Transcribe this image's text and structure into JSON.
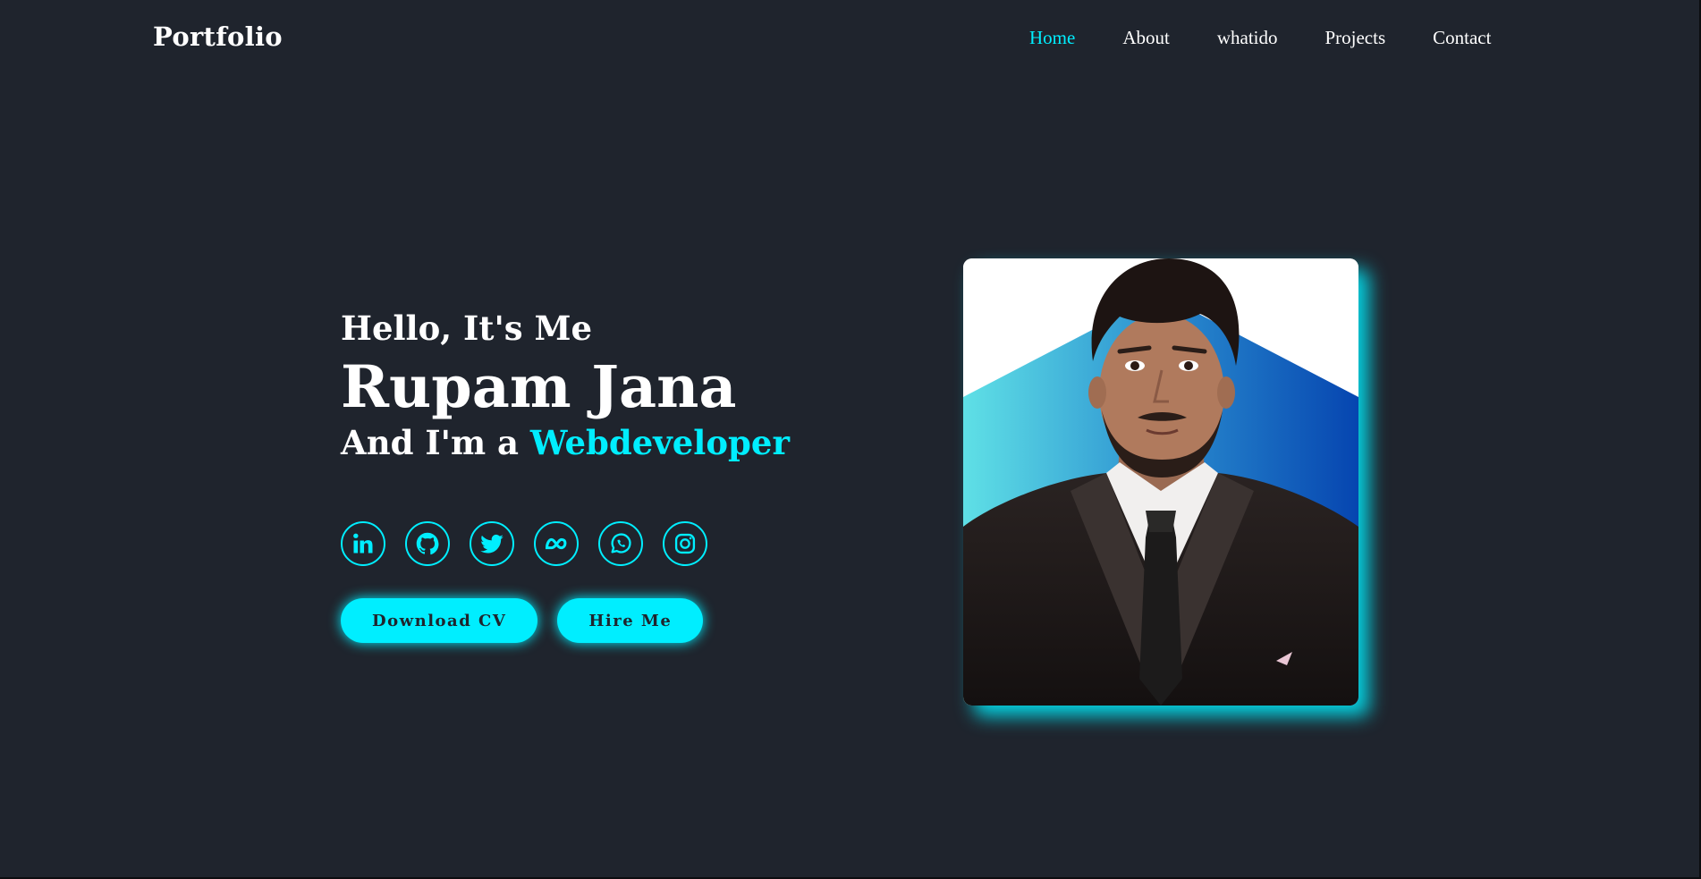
{
  "header": {
    "logo": "Portfolio",
    "nav": [
      {
        "label": "Home",
        "active": true
      },
      {
        "label": "About"
      },
      {
        "label": "whatido"
      },
      {
        "label": "Projects"
      },
      {
        "label": "Contact"
      }
    ]
  },
  "home": {
    "greeting": "Hello, It's Me",
    "name": "Rupam Jana",
    "role_prefix": "And I'm a",
    "role": "Webdeveloper",
    "socials": [
      {
        "icon": "linkedin-icon"
      },
      {
        "icon": "github-icon"
      },
      {
        "icon": "twitter-icon"
      },
      {
        "icon": "meta-icon"
      },
      {
        "icon": "whatsapp-icon"
      },
      {
        "icon": "instagram-icon"
      }
    ],
    "buttons": {
      "download": "Download CV",
      "hire": "Hire Me"
    }
  },
  "colors": {
    "background": "#1f242d",
    "accent": "#00eeff",
    "text": "#ffffff"
  }
}
